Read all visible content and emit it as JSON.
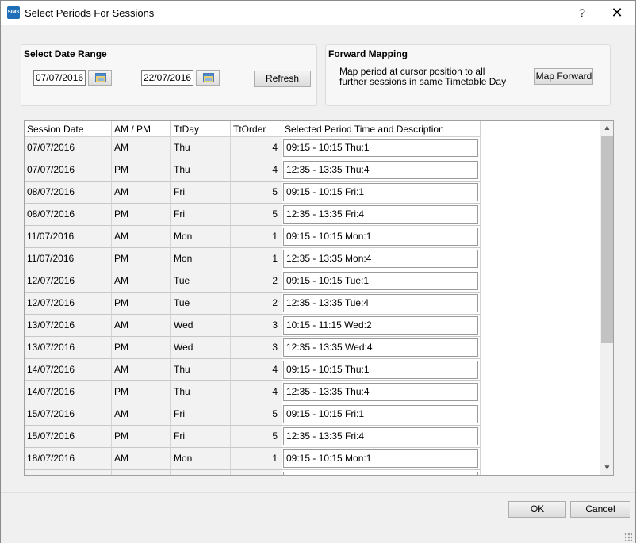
{
  "window": {
    "title": "Select Periods For Sessions",
    "app_icon": "SIMS",
    "help": "?",
    "close": "✕"
  },
  "date_range": {
    "title": "Select Date Range",
    "from": "07/07/2016",
    "to": "22/07/2016",
    "refresh_label": "Refresh"
  },
  "forward_mapping": {
    "title": "Forward Mapping",
    "desc_line1": "Map period at cursor position to all",
    "desc_line2": "further sessions in same Timetable Day",
    "button_label": "Map Forward"
  },
  "grid": {
    "columns": [
      "Session Date",
      "AM / PM",
      "TtDay",
      "TtOrder",
      "Selected Period Time and Description"
    ],
    "rows": [
      {
        "date": "07/07/2016",
        "ampm": "AM",
        "day": "Thu",
        "order": "4",
        "period": "09:15 - 10:15   Thu:1"
      },
      {
        "date": "07/07/2016",
        "ampm": "PM",
        "day": "Thu",
        "order": "4",
        "period": "12:35 - 13:35   Thu:4"
      },
      {
        "date": "08/07/2016",
        "ampm": "AM",
        "day": "Fri",
        "order": "5",
        "period": "09:15 - 10:15   Fri:1"
      },
      {
        "date": "08/07/2016",
        "ampm": "PM",
        "day": "Fri",
        "order": "5",
        "period": "12:35 - 13:35   Fri:4"
      },
      {
        "date": "11/07/2016",
        "ampm": "AM",
        "day": "Mon",
        "order": "1",
        "period": "09:15 - 10:15   Mon:1"
      },
      {
        "date": "11/07/2016",
        "ampm": "PM",
        "day": "Mon",
        "order": "1",
        "period": "12:35 - 13:35   Mon:4"
      },
      {
        "date": "12/07/2016",
        "ampm": "AM",
        "day": "Tue",
        "order": "2",
        "period": "09:15 - 10:15   Tue:1"
      },
      {
        "date": "12/07/2016",
        "ampm": "PM",
        "day": "Tue",
        "order": "2",
        "period": "12:35 - 13:35   Tue:4"
      },
      {
        "date": "13/07/2016",
        "ampm": "AM",
        "day": "Wed",
        "order": "3",
        "period": "10:15 - 11:15   Wed:2"
      },
      {
        "date": "13/07/2016",
        "ampm": "PM",
        "day": "Wed",
        "order": "3",
        "period": "12:35 - 13:35   Wed:4"
      },
      {
        "date": "14/07/2016",
        "ampm": "AM",
        "day": "Thu",
        "order": "4",
        "period": "09:15 - 10:15   Thu:1"
      },
      {
        "date": "14/07/2016",
        "ampm": "PM",
        "day": "Thu",
        "order": "4",
        "period": "12:35 - 13:35   Thu:4"
      },
      {
        "date": "15/07/2016",
        "ampm": "AM",
        "day": "Fri",
        "order": "5",
        "period": "09:15 - 10:15   Fri:1"
      },
      {
        "date": "15/07/2016",
        "ampm": "PM",
        "day": "Fri",
        "order": "5",
        "period": "12:35 - 13:35   Fri:4"
      },
      {
        "date": "18/07/2016",
        "ampm": "AM",
        "day": "Mon",
        "order": "1",
        "period": "09:15 - 10:15   Mon:1"
      },
      {
        "date": "",
        "ampm": "",
        "day": "",
        "order": "",
        "period": ""
      }
    ]
  },
  "footer": {
    "ok_label": "OK",
    "cancel_label": "Cancel"
  }
}
